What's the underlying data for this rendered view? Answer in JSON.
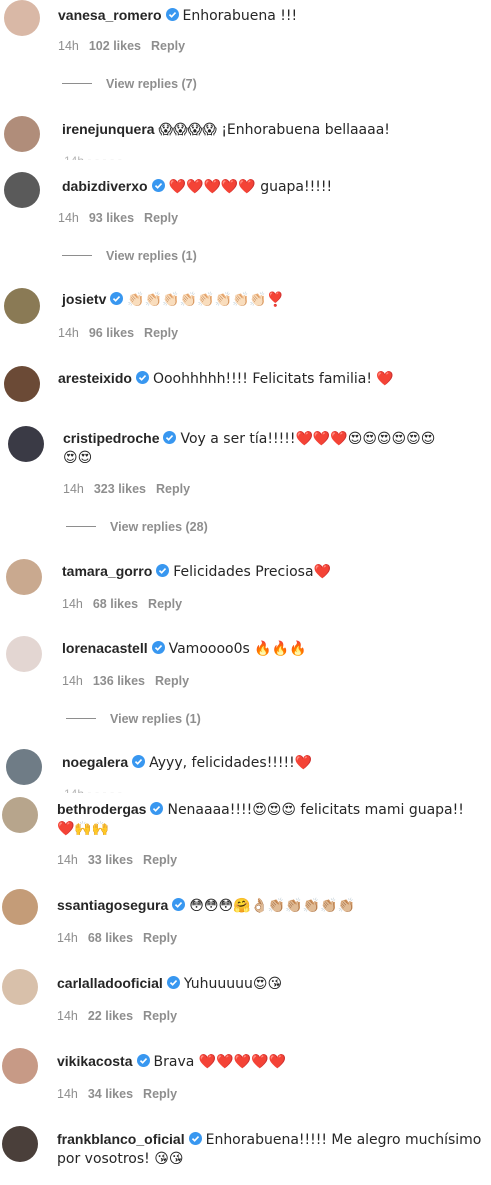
{
  "comments": [
    {
      "username": "vanesa_romero",
      "verified": true,
      "text": "Enhorabuena !!!",
      "time": "14h",
      "likes": "102 likes",
      "reply": "Reply",
      "view_replies": "View replies (7)",
      "avatar_color": "#d9b8a6"
    },
    {
      "username": "irenejunquera",
      "verified": false,
      "text": "😱😱😱😱 ¡Enhorabuena bellaaaa!",
      "avatar_color": "#b08d7a"
    },
    {
      "username": "dabizdiverxo",
      "verified": true,
      "text": "❤️❤️❤️❤️❤️ guapa!!!!!",
      "time": "14h",
      "likes": "93 likes",
      "reply": "Reply",
      "view_replies": "View replies (1)",
      "avatar_color": "#5a5a5a"
    },
    {
      "username": "josietv",
      "verified": true,
      "text": "👏🏻👏🏻👏🏻👏🏻👏🏻👏🏻👏🏻👏🏻❣️",
      "time": "14h",
      "likes": "96 likes",
      "reply": "Reply",
      "avatar_color": "#8a7a55"
    },
    {
      "username": "aresteixido",
      "verified": true,
      "text": "Ooohhhhh!!!! Felicitats familia! ❤️",
      "avatar_color": "#6b4a36"
    },
    {
      "username": "cristipedroche",
      "verified": true,
      "text": "Voy a ser tía!!!!!❤️❤️❤️😍😍😍😍😍😍",
      "text2": "😍😍",
      "time": "14h",
      "likes": "323 likes",
      "reply": "Reply",
      "view_replies": "View replies (28)",
      "avatar_color": "#3a3a45"
    },
    {
      "username": "tamara_gorro",
      "verified": true,
      "text": "Felicidades Preciosa❤️",
      "time": "14h",
      "likes": "68 likes",
      "reply": "Reply",
      "avatar_color": "#c9a98f"
    },
    {
      "username": "lorenacastell",
      "verified": true,
      "text": "Vamoooo0s 🔥🔥🔥",
      "time": "14h",
      "likes": "136 likes",
      "reply": "Reply",
      "view_replies": "View replies (1)",
      "avatar_color": "#e3d6d2"
    },
    {
      "username": "noegalera",
      "verified": true,
      "text": "Ayyy, felicidades!!!!!❤️",
      "avatar_color": "#6f7c86"
    },
    {
      "username": "bethrodergas",
      "verified": true,
      "text": "Nenaaaa!!!!😍😍😍 felicitats mami guapa!!",
      "text2": "❤️🙌🙌",
      "time": "14h",
      "likes": "33 likes",
      "reply": "Reply",
      "avatar_color": "#b7a58c"
    },
    {
      "username": "ssantiagosegura",
      "verified": true,
      "text": "😳😳😳🤗👌🏼👏🏼👏🏼👏🏼👏🏼👏🏼",
      "time": "14h",
      "likes": "68 likes",
      "reply": "Reply",
      "avatar_color": "#c49c78"
    },
    {
      "username": "carlalladooficial",
      "verified": true,
      "text": "Yuhuuuuu😍😘",
      "time": "14h",
      "likes": "22 likes",
      "reply": "Reply",
      "avatar_color": "#d8c0aa"
    },
    {
      "username": "vikikacosta",
      "verified": true,
      "text": "Brava ❤️❤️❤️❤️❤️",
      "time": "14h",
      "likes": "34 likes",
      "reply": "Reply",
      "avatar_color": "#c79a86"
    },
    {
      "username": "frankblanco_oficial",
      "verified": true,
      "text": "Enhorabuena!!!!! Me alegro muchísimo",
      "text2": "por vosotros! 😘😘",
      "avatar_color": "#4a3f3a"
    }
  ],
  "colors": {
    "verified": "#3897f0",
    "meta": "#8e8e8e",
    "text": "#262626"
  }
}
